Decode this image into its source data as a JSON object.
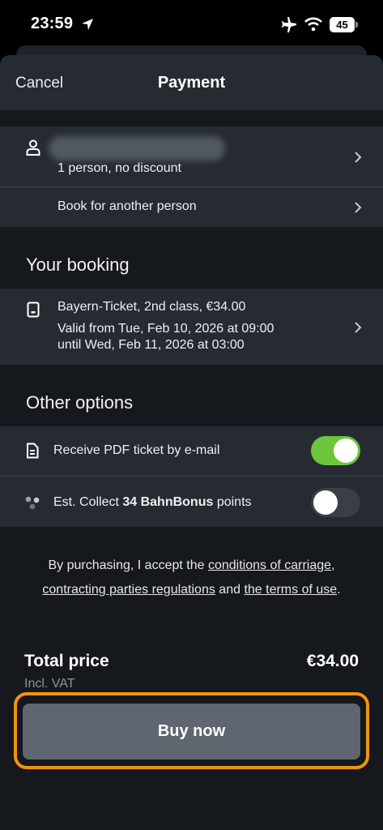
{
  "status": {
    "time": "23:59",
    "battery": "45"
  },
  "nav": {
    "cancel": "Cancel",
    "title": "Payment"
  },
  "traveler": {
    "subtitle": "1 person, no discount",
    "book_other": "Book for another person"
  },
  "booking": {
    "section_title": "Your booking",
    "ticket": "Bayern-Ticket, 2nd class, €34.00",
    "valid_from": "Valid from Tue, Feb 10, 2026 at 09:00",
    "valid_until": "until Wed, Feb 11, 2026 at 03:00"
  },
  "options": {
    "section_title": "Other options",
    "pdf_label": "Receive PDF ticket by e-mail",
    "pdf_enabled": true,
    "bonus_prefix": "Est. Collect ",
    "bonus_bold": "34 BahnBonus",
    "bonus_suffix": " points",
    "bonus_enabled": false
  },
  "legal": {
    "prefix": "By purchasing, I accept the ",
    "link1": "conditions of carriage",
    "sep1": ", ",
    "link2": "contracting parties regulations",
    "and": " and ",
    "link3": "the terms of use",
    "end": "."
  },
  "total": {
    "label": "Total price",
    "value": "€34.00",
    "vat": "Incl. VAT"
  },
  "buy_label": "Buy now",
  "colors": {
    "accent_toggle": "#6cc53a",
    "highlight": "#f4930a",
    "button": "#5f666f"
  },
  "icons": [
    "location-arrow-icon",
    "airplane-icon",
    "wifi-icon",
    "person-icon",
    "chevron-right-icon",
    "ticket-phone-icon",
    "document-icon",
    "bonus-dots-icon"
  ]
}
